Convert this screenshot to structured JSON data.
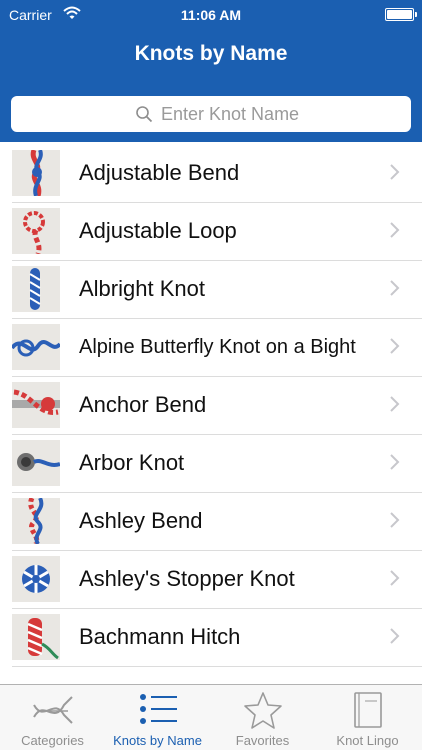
{
  "status_bar": {
    "carrier": "Carrier",
    "time": "11:06 AM"
  },
  "nav": {
    "title": "Knots by Name"
  },
  "search": {
    "placeholder": "Enter Knot Name"
  },
  "knots": [
    {
      "name": "Adjustable Bend"
    },
    {
      "name": "Adjustable Loop"
    },
    {
      "name": "Albright Knot"
    },
    {
      "name": "Alpine Butterfly Knot on a Bight"
    },
    {
      "name": "Anchor Bend"
    },
    {
      "name": "Arbor Knot"
    },
    {
      "name": "Ashley Bend"
    },
    {
      "name": "Ashley's Stopper Knot"
    },
    {
      "name": "Bachmann Hitch"
    }
  ],
  "tabs": [
    {
      "label": "Categories",
      "icon": "knot-icon",
      "active": false
    },
    {
      "label": "Knots by Name",
      "icon": "list-icon",
      "active": true
    },
    {
      "label": "Favorites",
      "icon": "star-icon",
      "active": false
    },
    {
      "label": "Knot Lingo",
      "icon": "book-icon",
      "active": false
    }
  ],
  "colors": {
    "accent": "#1b5fb1",
    "inactive": "#8e8e8e"
  }
}
